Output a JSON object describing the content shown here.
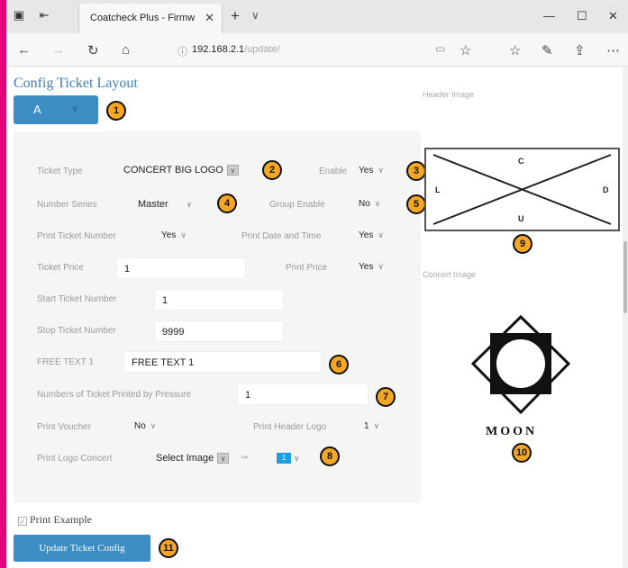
{
  "browser": {
    "tab_title": "Coatcheck Plus - Firmw",
    "url_host": "192.168.2.1",
    "url_path": "/update/"
  },
  "page": {
    "title": "Config Ticket Layout",
    "layout_value": "A",
    "fields": {
      "ticket_type_label": "Ticket Type",
      "ticket_type_value": "CONCERT BIG LOGO",
      "enable_label": "Enable",
      "enable_value": "Yes",
      "number_series_label": "Number Series",
      "number_series_value": "Master",
      "group_enable_label": "Group Enable",
      "group_enable_value": "No",
      "print_ticket_number_label": "Print Ticket Number",
      "print_ticket_number_value": "Yes",
      "print_date_time_label": "Print Date and Time",
      "print_date_time_value": "Yes",
      "ticket_price_label": "Ticket Price",
      "ticket_price_value": "1",
      "print_price_label": "Print Price",
      "print_price_value": "Yes",
      "start_ticket_label": "Start Ticket Number",
      "start_ticket_value": "1",
      "stop_ticket_label": "Stop Ticket Number",
      "stop_ticket_value": "9999",
      "free_text_label": "FREE TEXT 1",
      "free_text_value": "FREE TEXT 1",
      "tickets_pressure_label": "Numbers of Ticket Printed by Pressure",
      "tickets_pressure_value": "1",
      "print_voucher_label": "Print Voucher",
      "print_voucher_value": "No",
      "print_header_logo_label": "Print Header Logo",
      "print_header_logo_value": "1",
      "print_logo_concert_label": "Print Logo Concert",
      "print_logo_concert_value": "Select Image",
      "arrow_symbol": "⇒",
      "logo_color_value": "1"
    },
    "header_image_label": "Header Image",
    "header_image_letters": {
      "top": "C",
      "left": "L",
      "right": "D",
      "bottom": "U"
    },
    "concert_image_label": "Concert Image",
    "concert_image_text": "MOON",
    "print_example_label": "Print Example",
    "update_button_label": "Update Ticket Config"
  },
  "badges": [
    "1",
    "2",
    "3",
    "4",
    "5",
    "6",
    "7",
    "8",
    "9",
    "10",
    "11"
  ],
  "colors": {
    "accent": "#3d8dc4",
    "badge": "#f5a623",
    "border_frame": "#e6007e",
    "title": "#3e7fb8"
  }
}
